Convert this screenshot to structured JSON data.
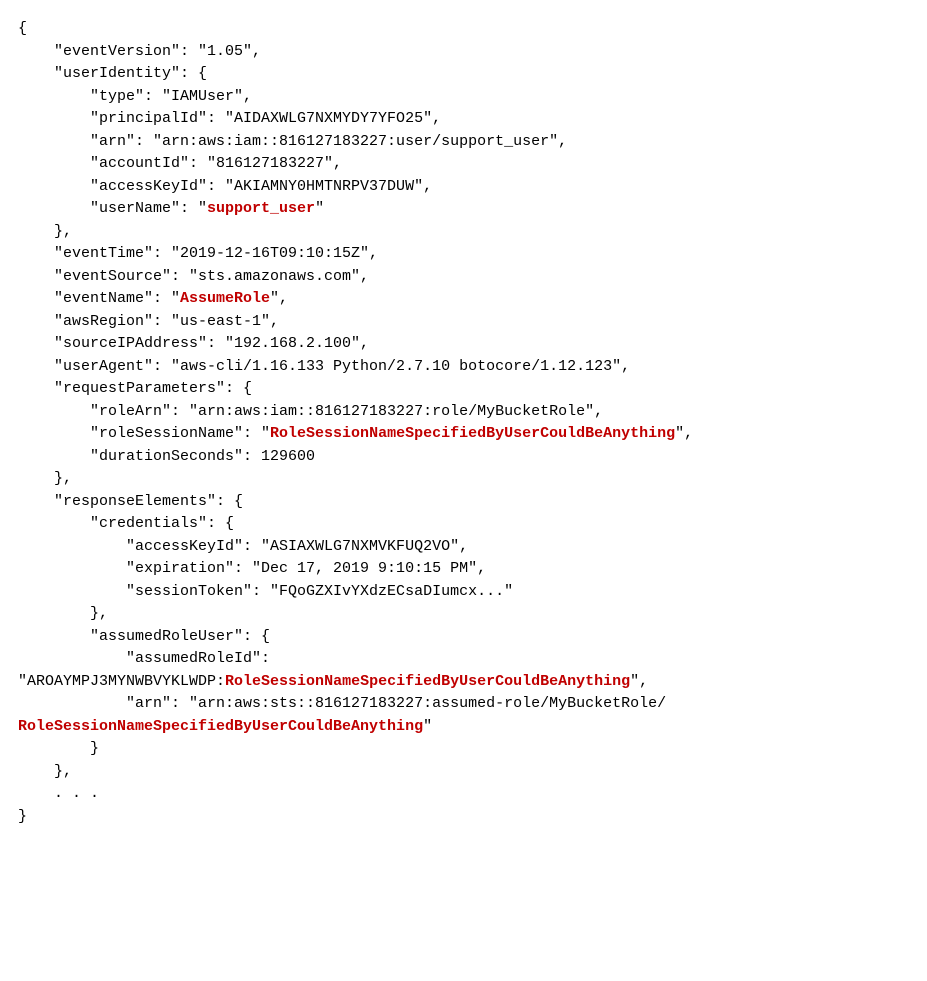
{
  "highlights": {
    "support_user": "support_user",
    "assume_role": "AssumeRole",
    "role_session_name": "RoleSessionNameSpecifiedByUserCouldBeAnything"
  },
  "lines": {
    "0": "{",
    "1": "    \"eventVersion\": \"1.05\",",
    "2": "    \"userIdentity\": {",
    "3": "        \"type\": \"IAMUser\",",
    "4": "        \"principalId\": \"AIDAXWLG7NXMYDY7YFO25\",",
    "5": "        \"arn\": \"arn:aws:iam::816127183227:user/support_user\",",
    "6": "        \"accountId\": \"816127183227\",",
    "7": "        \"accessKeyId\": \"AKIAMNY0HMTNRPV37DUW\",",
    "8a": "        \"userName\": \"",
    "8b": "\"",
    "9": "    },",
    "10": "    \"eventTime\": \"2019-12-16T09:10:15Z\",",
    "11": "    \"eventSource\": \"sts.amazonaws.com\",",
    "12a": "    \"eventName\": \"",
    "12b": "\",",
    "13": "    \"awsRegion\": \"us-east-1\",",
    "14": "    \"sourceIPAddress\": \"192.168.2.100\",",
    "15": "    \"userAgent\": \"aws-cli/1.16.133 Python/2.7.10 botocore/1.12.123\",",
    "16": "    \"requestParameters\": {",
    "17": "        \"roleArn\": \"arn:aws:iam::816127183227:role/MyBucketRole\",",
    "18a": "        \"roleSessionName\": \"",
    "18b": "\",",
    "19": "        \"durationSeconds\": 129600",
    "20": "    },",
    "21": "    \"responseElements\": {",
    "22": "        \"credentials\": {",
    "23": "            \"accessKeyId\": \"ASIAXWLG7NXMVKFUQ2VO\",",
    "24": "            \"expiration\": \"Dec 17, 2019 9:10:15 PM\",",
    "25": "            \"sessionToken\": \"FQoGZXIvYXdzECsaDIumcx...\"",
    "26": "        },",
    "27": "        \"assumedRoleUser\": {",
    "28": "            \"assumedRoleId\":",
    "29a": "\"AROAYMPJ3MYNWBVYKLWDP:",
    "29b": "\",",
    "30": "            \"arn\": \"arn:aws:sts::816127183227:assumed-role/MyBucketRole/",
    "31b": "\"",
    "32": "        }",
    "33": "    },",
    "34": "    . . .",
    "35": "}"
  }
}
